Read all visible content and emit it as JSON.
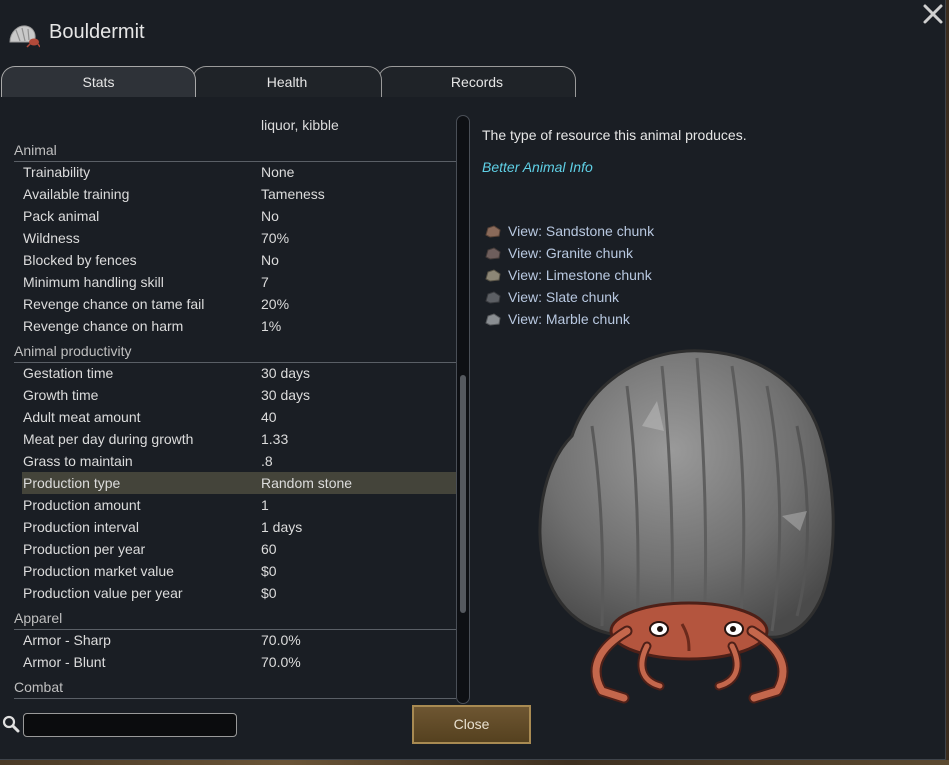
{
  "window": {
    "title": "Bouldermit",
    "tabs": [
      {
        "label": "Stats",
        "active": true
      },
      {
        "label": "Health",
        "active": false
      },
      {
        "label": "Records",
        "active": false
      }
    ]
  },
  "stats": {
    "partial_top_text": "liquor, kibble",
    "categories": [
      {
        "name": "Animal",
        "rows": [
          {
            "label": "Trainability",
            "value": "None"
          },
          {
            "label": "Available training",
            "value": "Tameness"
          },
          {
            "label": "Pack animal",
            "value": "No"
          },
          {
            "label": "Wildness",
            "value": "70%"
          },
          {
            "label": "Blocked by fences",
            "value": "No"
          },
          {
            "label": "Minimum handling skill",
            "value": "7"
          },
          {
            "label": "Revenge chance on tame fail",
            "value": "20%"
          },
          {
            "label": "Revenge chance on harm",
            "value": "1%"
          }
        ]
      },
      {
        "name": "Animal productivity",
        "rows": [
          {
            "label": "Gestation time",
            "value": "30 days"
          },
          {
            "label": "Growth time",
            "value": "30 days"
          },
          {
            "label": "Adult meat amount",
            "value": "40"
          },
          {
            "label": "Meat per day during growth",
            "value": "1.33"
          },
          {
            "label": "Grass to maintain",
            "value": ".8"
          },
          {
            "label": "Production type",
            "value": "Random stone",
            "highlighted": true
          },
          {
            "label": "Production amount",
            "value": "1"
          },
          {
            "label": "Production interval",
            "value": "1 days"
          },
          {
            "label": "Production per year",
            "value": "60"
          },
          {
            "label": "Production market value",
            "value": "$0"
          },
          {
            "label": "Production value per year",
            "value": "$0"
          }
        ]
      },
      {
        "name": "Apparel",
        "rows": [
          {
            "label": "Armor - Sharp",
            "value": "70.0%"
          },
          {
            "label": "Armor - Blunt",
            "value": "70.0%"
          }
        ]
      },
      {
        "name": "Combat",
        "rows": []
      }
    ]
  },
  "detail": {
    "description": "The type of resource this animal produces.",
    "link": "Better Animal Info",
    "hyperlinks": [
      {
        "label": "View: Sandstone chunk",
        "color": "#8a6a5a"
      },
      {
        "label": "View: Granite chunk",
        "color": "#6e5e5c"
      },
      {
        "label": "View: Limestone chunk",
        "color": "#8c8676"
      },
      {
        "label": "View: Slate chunk",
        "color": "#5c5f64"
      },
      {
        "label": "View: Marble chunk",
        "color": "#8a8e92"
      }
    ]
  },
  "footer": {
    "search_value": "",
    "close_label": "Close"
  },
  "colors": {
    "window_bg": "#1a1e24",
    "highlight_row": "#44443a",
    "link": "#5fd0e6",
    "hyperlink": "#b8c8e0",
    "button": "#6e5632"
  }
}
